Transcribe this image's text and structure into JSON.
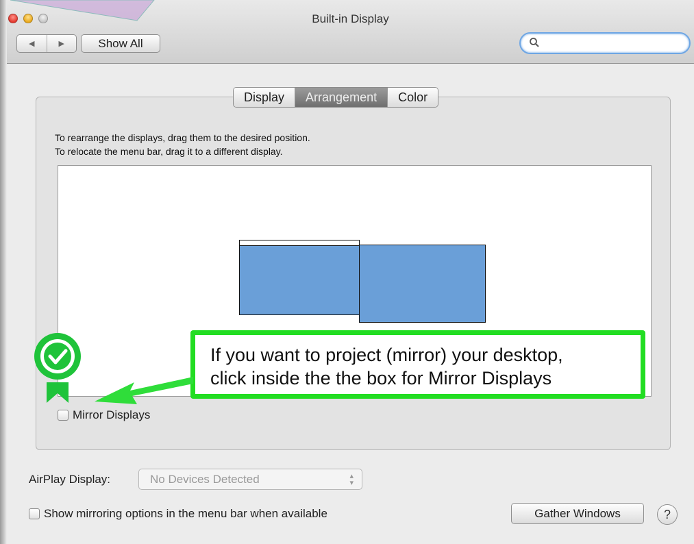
{
  "window": {
    "title": "Built-in Display"
  },
  "toolbar": {
    "back_glyph": "◀",
    "forward_glyph": "▶",
    "show_all_label": "Show All",
    "search_placeholder": "",
    "search_icon": "search-icon"
  },
  "tabs": [
    {
      "label": "Display",
      "active": false
    },
    {
      "label": "Arrangement",
      "active": true
    },
    {
      "label": "Color",
      "active": false
    }
  ],
  "arrangement": {
    "instruction_1": "To rearrange the displays, drag them to the desired position.",
    "instruction_2": "To relocate the menu bar, drag it to a different display.",
    "mirror_label": "Mirror Displays",
    "mirror_checked": false
  },
  "callout": {
    "line_1": "If you want to project (mirror) your desktop,",
    "line_2": "click inside the the box for Mirror Displays",
    "border_color": "#22dd22"
  },
  "bottom": {
    "airplay_label": "AirPlay Display:",
    "airplay_value": "No Devices Detected",
    "show_mirroring_label": "Show mirroring options in the menu bar when available",
    "show_mirroring_checked": false,
    "gather_label": "Gather Windows",
    "help_label": "?"
  },
  "colors": {
    "display_fill": "#6a9fd8",
    "accent": "#6ea6e4",
    "callout_green": "#22dd22"
  }
}
